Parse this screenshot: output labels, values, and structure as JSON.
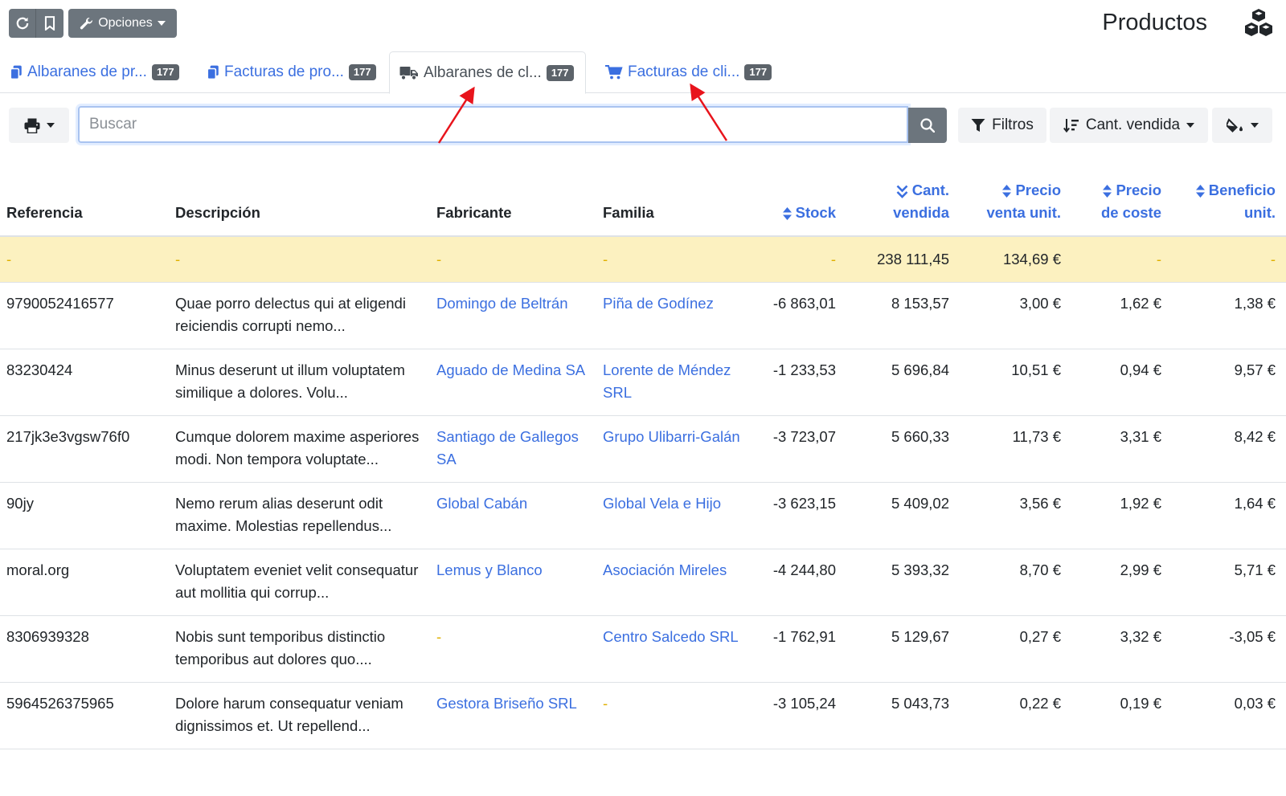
{
  "toolbar": {
    "options_label": "Opciones"
  },
  "page": {
    "title": "Productos"
  },
  "tabs": [
    {
      "label": "Albaranes de pr...",
      "count": "177",
      "icon": "copy-icon",
      "active": false
    },
    {
      "label": "Facturas de pro...",
      "count": "177",
      "icon": "copy-icon",
      "active": false
    },
    {
      "label": "Albaranes de cl...",
      "count": "177",
      "icon": "truck-icon",
      "active": true
    },
    {
      "label": "Facturas de cli...",
      "count": "177",
      "icon": "cart-icon",
      "active": false
    }
  ],
  "search": {
    "placeholder": "Buscar",
    "value": ""
  },
  "controls": {
    "filters_label": "Filtros",
    "sort_label": "Cant. vendida"
  },
  "colors": {
    "accent": "#3b6fe0",
    "totals_row": "#fcf1c0",
    "annotation": "#e8141c"
  },
  "table": {
    "headers": {
      "reference": "Referencia",
      "description": "Descripción",
      "manufacturer": "Fabricante",
      "family": "Familia",
      "stock": "Stock",
      "qty_sold_1": "Cant.",
      "qty_sold_2": "vendida",
      "unit_price_1": "Precio",
      "unit_price_2": "venta unit.",
      "cost_price_1": "Precio",
      "cost_price_2": "de coste",
      "unit_profit_1": "Beneficio",
      "unit_profit_2": "unit."
    },
    "totals": {
      "reference": "-",
      "description": "-",
      "manufacturer": "-",
      "family": "-",
      "stock": "-",
      "qty_sold": "238 111,45",
      "unit_price": "134,69 €",
      "cost_price": "-",
      "unit_profit": "-"
    },
    "rows": [
      {
        "reference": "9790052416577",
        "description": "Quae porro delectus qui at eligendi reiciendis corrupti nemo...",
        "manufacturer": "Domingo de Beltrán",
        "family": "Piña de Godínez",
        "stock": "-6 863,01",
        "qty_sold": "8 153,57",
        "unit_price": "3,00 €",
        "cost_price": "1,62 €",
        "unit_profit": "1,38 €"
      },
      {
        "reference": "83230424",
        "description": "Minus deserunt ut illum voluptatem similique a dolores. Volu...",
        "manufacturer": "Aguado de Medina SA",
        "family": "Lorente de Méndez SRL",
        "stock": "-1 233,53",
        "qty_sold": "5 696,84",
        "unit_price": "10,51 €",
        "cost_price": "0,94 €",
        "unit_profit": "9,57 €"
      },
      {
        "reference": "217jk3e3vgsw76f0",
        "description": "Cumque dolorem maxime asperiores modi. Non tempora voluptate...",
        "manufacturer": "Santiago de Gallegos SA",
        "family": "Grupo Ulibarri-Galán",
        "stock": "-3 723,07",
        "qty_sold": "5 660,33",
        "unit_price": "11,73 €",
        "cost_price": "3,31 €",
        "unit_profit": "8,42 €"
      },
      {
        "reference": "90jy",
        "description": "Nemo rerum alias deserunt odit maxime. Molestias repellendus...",
        "manufacturer": "Global Cabán",
        "family": "Global Vela e Hijo",
        "stock": "-3 623,15",
        "qty_sold": "5 409,02",
        "unit_price": "3,56 €",
        "cost_price": "1,92 €",
        "unit_profit": "1,64 €"
      },
      {
        "reference": "moral.org",
        "description": "Voluptatem eveniet velit consequatur aut mollitia qui corrup...",
        "manufacturer": "Lemus y Blanco",
        "family": "Asociación Mireles",
        "stock": "-4 244,80",
        "qty_sold": "5 393,32",
        "unit_price": "8,70 €",
        "cost_price": "2,99 €",
        "unit_profit": "5,71 €"
      },
      {
        "reference": "8306939328",
        "description": "Nobis sunt temporibus distinctio temporibus aut dolores quo....",
        "manufacturer": "-",
        "family": "Centro Salcedo SRL",
        "stock": "-1 762,91",
        "qty_sold": "5 129,67",
        "unit_price": "0,27 €",
        "cost_price": "3,32 €",
        "unit_profit": "-3,05 €"
      },
      {
        "reference": "5964526375965",
        "description": "Dolore harum consequatur veniam dignissimos et. Ut repellend...",
        "manufacturer": "Gestora Briseño SRL",
        "family": "-",
        "stock": "-3 105,24",
        "qty_sold": "5 043,73",
        "unit_price": "0,22 €",
        "cost_price": "0,19 €",
        "unit_profit": "0,03 €"
      }
    ]
  }
}
